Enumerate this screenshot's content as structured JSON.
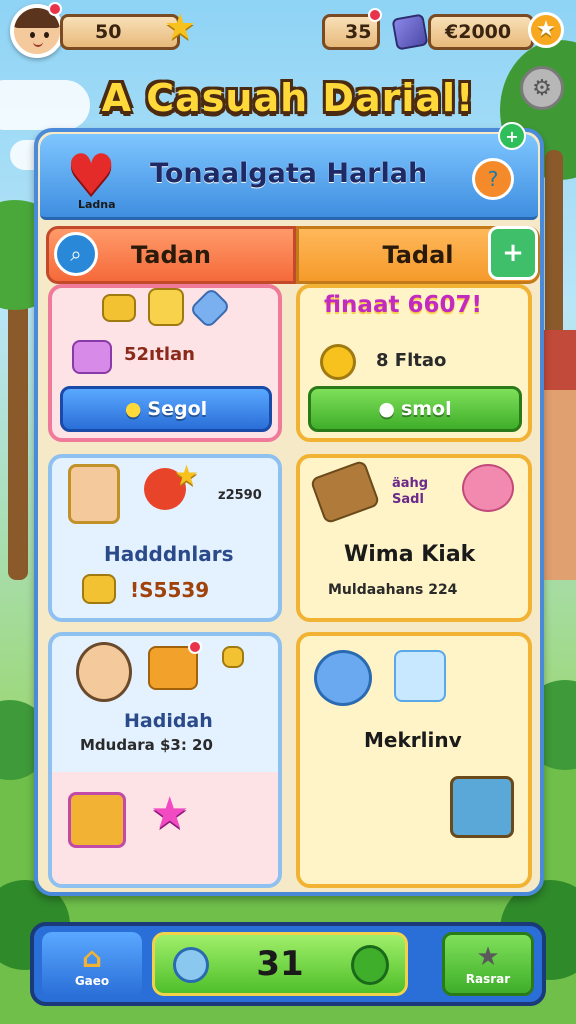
{
  "topbar": {
    "coins_value": "50",
    "energy_value": "35",
    "gems_value": "€2000"
  },
  "title": "A Casuah Darial!",
  "panel": {
    "heart_label": "Ladna",
    "header_title": "Tonaalgata Harlah",
    "tabs": [
      {
        "label": "Tadan"
      },
      {
        "label": "Tadal"
      }
    ]
  },
  "cards": {
    "shop_left": {
      "price_text": "52ıtlan",
      "button_label": "Segol"
    },
    "shop_right": {
      "banner_text": "finaat 6607!",
      "price_text": "8 Fltao",
      "button_label": "smol"
    },
    "mid_left": {
      "counter": "z2590",
      "title": "Hadddnlars",
      "value": "!S5539"
    },
    "mid_right": {
      "badge_text": "äahg Sadl",
      "title": "Wima Kiak",
      "subtitle": "Muldaahans 224"
    },
    "low_left": {
      "title": "Hadidah",
      "subtitle": "Mdudara $3: 20"
    },
    "low_right": {
      "title": "Mekrlinv"
    }
  },
  "bottombar": {
    "home_label": "Gaeo",
    "center_value": "31",
    "right_label": "Rasrar"
  },
  "colors": {
    "panel_border": "#4a8ad8",
    "title_yellow": "#ffd83a",
    "button_blue": "#2a6fd8",
    "button_green": "#3fae2a"
  }
}
